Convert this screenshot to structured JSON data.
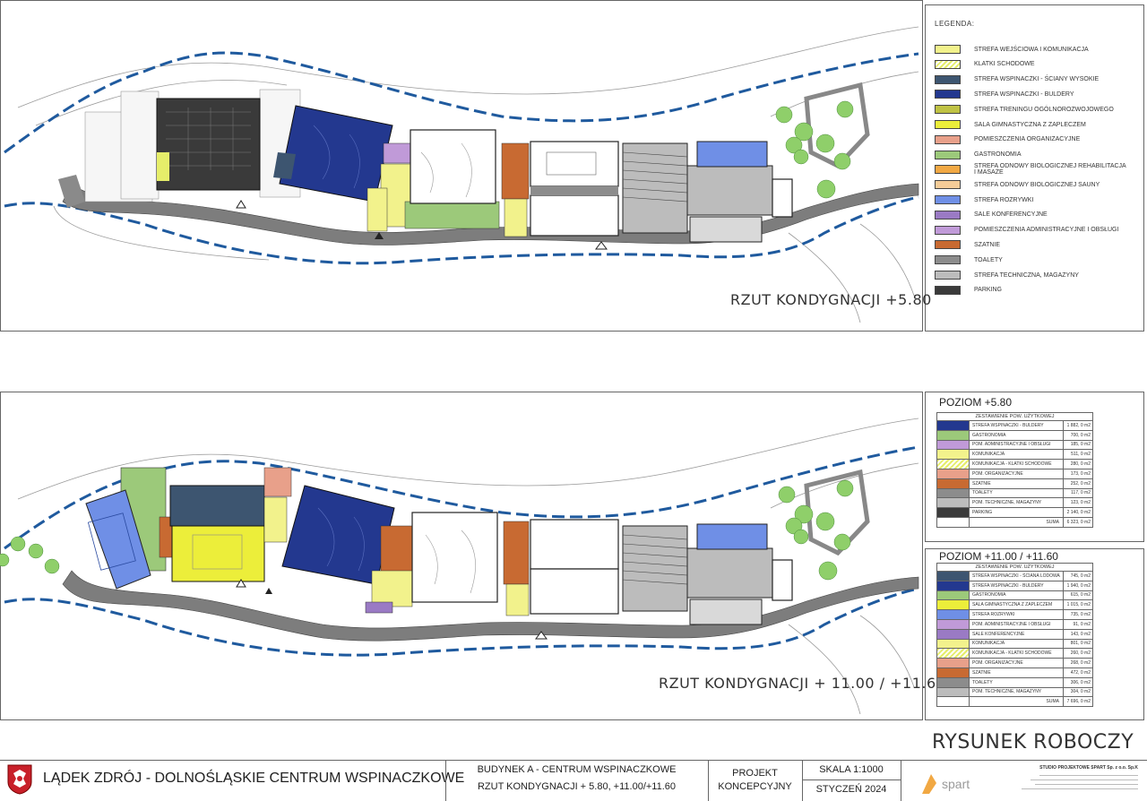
{
  "plan_top": {
    "title": "RZUT KONDYGNACJI +5.80"
  },
  "plan_bottom": {
    "title": "RZUT KONDYGNACJI + 11.00 / +11.60"
  },
  "legend": {
    "title": "LEGENDA:",
    "items": [
      {
        "label": "STREFA WEJŚCIOWA I KOMUNIKACJA",
        "color": "#f2f28c",
        "hatch": false
      },
      {
        "label": "KLATKI SCHODOWE",
        "color": "#e6ee6a",
        "hatch": true
      },
      {
        "label": "STREFA WSPINACZKI - ŚCIANY WYSOKIE",
        "color": "#3d5570",
        "hatch": false
      },
      {
        "label": "STREFA WSPINACZKI - BULDERY",
        "color": "#23388f",
        "hatch": false
      },
      {
        "label": "STREFA TRENINGU OGÓLNOROZWOJOWEGO",
        "color": "#bfc244",
        "hatch": false
      },
      {
        "label": "SALA GIMNASTYCZNA Z ZAPLECZEM",
        "color": "#ecee3a",
        "hatch": false
      },
      {
        "label": "POMIESZCZENIA ORGANIZACYJNE",
        "color": "#e8a08a",
        "hatch": false
      },
      {
        "label": "GASTRONOMIA",
        "color": "#9cc97a",
        "hatch": false
      },
      {
        "label": "STREFA ODNOWY BIOLOGICZNEJ REHABILITACJA I MASAŻE",
        "color": "#f1a843",
        "hatch": false
      },
      {
        "label": "STREFA ODNOWY BIOLOGICZNEJ SAUNY",
        "color": "#f5cc98",
        "hatch": false
      },
      {
        "label": "STREFA ROZRYWKI",
        "color": "#6f8fe6",
        "hatch": false
      },
      {
        "label": "SALE KONFERENCYJNE",
        "color": "#9a7ac4",
        "hatch": false
      },
      {
        "label": "POMIESZCZENIA ADMINISTRACYJNE I OBSŁUGI",
        "color": "#c09ad8",
        "hatch": false
      },
      {
        "label": "SZATNIE",
        "color": "#c86a32",
        "hatch": false
      },
      {
        "label": "TOALETY",
        "color": "#8c8c8c",
        "hatch": false
      },
      {
        "label": "STREFA TECHNICZNA, MAGAZYNY",
        "color": "#bcbcbc",
        "hatch": false
      },
      {
        "label": "PARKING",
        "color": "#3a3a3a",
        "hatch": false
      }
    ]
  },
  "table_580": {
    "caption": "POZIOM +5.80",
    "header": "ZESTAWIENIE POW. UŻYTKOWEJ",
    "rows": [
      {
        "name": "STREFA WSPINACZKI - BULDERY",
        "area": "1 882, 0 m2",
        "color": "#23388f",
        "hatch": false
      },
      {
        "name": "GASTRONOMIA",
        "area": "700, 0 m2",
        "color": "#9cc97a",
        "hatch": false
      },
      {
        "name": "POM. ADMINISTRACYJNE I OBSŁUGI",
        "area": "185, 0 m2",
        "color": "#c09ad8",
        "hatch": false
      },
      {
        "name": "KOMUNIKACJA",
        "area": "511, 0 m2",
        "color": "#f2f28c",
        "hatch": false
      },
      {
        "name": "KOMUNIKACJA - KLATKI SCHODOWE",
        "area": "280, 0 m2",
        "color": "#e6ee6a",
        "hatch": true
      },
      {
        "name": "POM. ORGANIZACYJNE",
        "area": "173, 0 m2",
        "color": "#e8a08a",
        "hatch": false
      },
      {
        "name": "SZATNIE",
        "area": "252, 0 m2",
        "color": "#c86a32",
        "hatch": false
      },
      {
        "name": "TOALETY",
        "area": "117, 0 m2",
        "color": "#8c8c8c",
        "hatch": false
      },
      {
        "name": "POM. TECHNICZNE, MAGAZYNY",
        "area": "123, 0 m2",
        "color": "#bcbcbc",
        "hatch": false
      },
      {
        "name": "PARKING",
        "area": "2 140, 0 m2",
        "color": "#3a3a3a",
        "hatch": false
      }
    ],
    "sum_label": "SUMA",
    "sum_value": "6 323, 0 m2"
  },
  "table_1100": {
    "caption": "POZIOM +11.00 / +11.60",
    "header": "ZESTAWIENIE POW. UŻYTKOWEJ",
    "rows": [
      {
        "name": "STREFA WSPINACZKI - ŚCIANA LODOWA",
        "area": "745, 0 m2",
        "color": "#3d5570",
        "hatch": false
      },
      {
        "name": "STREFA WSPINACZKI - BULDERY",
        "area": "1 940, 0 m2",
        "color": "#23388f",
        "hatch": false
      },
      {
        "name": "GASTRONOMIA",
        "area": "615, 0 m2",
        "color": "#9cc97a",
        "hatch": false
      },
      {
        "name": "SALA GIMNASTYCZNA Z ZAPLECZEM",
        "area": "1 015, 0 m2",
        "color": "#ecee3a",
        "hatch": false
      },
      {
        "name": "STREFA ROZRYWKI",
        "area": "735, 0 m2",
        "color": "#6f8fe6",
        "hatch": false
      },
      {
        "name": "POM. ADMINISTRACYJNE I OBSŁUGI",
        "area": "91, 0 m2",
        "color": "#c09ad8",
        "hatch": false
      },
      {
        "name": "SALE KONFERENCYJNE",
        "area": "143, 0 m2",
        "color": "#9a7ac4",
        "hatch": false
      },
      {
        "name": "KOMUNIKACJA",
        "area": "801, 0 m2",
        "color": "#f2f28c",
        "hatch": false
      },
      {
        "name": "KOMUNIKACJA - KLATKI SCHODOWE",
        "area": "260, 0 m2",
        "color": "#e6ee6a",
        "hatch": true
      },
      {
        "name": "POM. ORGANIZACYJNE",
        "area": "268, 0 m2",
        "color": "#e8a08a",
        "hatch": false
      },
      {
        "name": "SZATNIE",
        "area": "472, 0 m2",
        "color": "#c86a32",
        "hatch": false
      },
      {
        "name": "TOALETY",
        "area": "306, 0 m2",
        "color": "#8c8c8c",
        "hatch": false
      },
      {
        "name": "POM. TECHNICZNE, MAGAZYNY",
        "area": "304, 0 m2",
        "color": "#bcbcbc",
        "hatch": false
      }
    ],
    "sum_label": "SUMA",
    "sum_value": "7 696, 0 m2"
  },
  "stamp": "RYSUNEK ROBOCZY",
  "title_block": {
    "project": "LĄDEK ZDRÓJ - DOLNOŚLĄSKIE CENTRUM  WSPINACZKOWE",
    "building": "BUDYNEK A - CENTRUM WSPINACZKOWE",
    "drawing": "RZUT KONDYGNACJI  + 5.80, +11.00/+11.60",
    "phase_line1": "PROJEKT",
    "phase_line2": "KONCEPCYJNY",
    "scale": "SKALA 1:1000",
    "date": "STYCZEŃ 2024",
    "firm_name": "STUDIO PROJEKTOWE SPART Sp. z o.o.  Sp.K",
    "firm_logo_text": "spart"
  }
}
